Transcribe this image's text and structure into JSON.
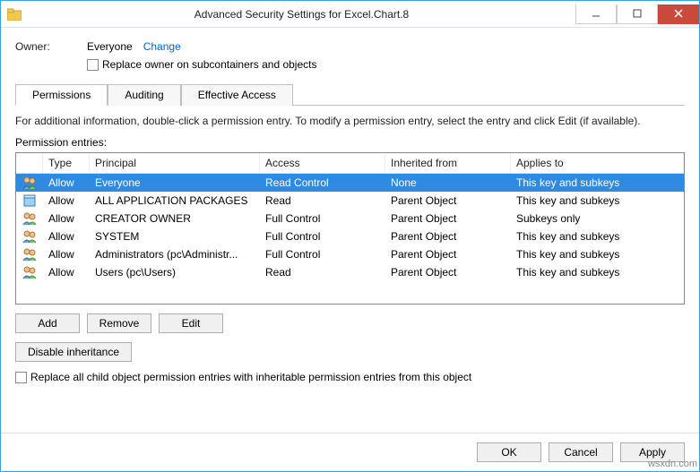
{
  "window": {
    "title": "Advanced Security Settings for Excel.Chart.8"
  },
  "owner": {
    "label": "Owner:",
    "value": "Everyone",
    "change_link": "Change",
    "replace_checkbox": "Replace owner on subcontainers and objects"
  },
  "tabs": {
    "permissions": "Permissions",
    "auditing": "Auditing",
    "effective_access": "Effective Access"
  },
  "info_text": "For additional information, double-click a permission entry. To modify a permission entry, select the entry and click Edit (if available).",
  "entries_label": "Permission entries:",
  "columns": {
    "type": "Type",
    "principal": "Principal",
    "access": "Access",
    "inherited": "Inherited from",
    "applies": "Applies to"
  },
  "rows": [
    {
      "type": "Allow",
      "principal": "Everyone",
      "access": "Read Control",
      "inherited": "None",
      "applies": "This key and subkeys",
      "icon": "users",
      "selected": true
    },
    {
      "type": "Allow",
      "principal": "ALL APPLICATION PACKAGES",
      "access": "Read",
      "inherited": "Parent Object",
      "applies": "This key and subkeys",
      "icon": "package",
      "selected": false
    },
    {
      "type": "Allow",
      "principal": "CREATOR OWNER",
      "access": "Full Control",
      "inherited": "Parent Object",
      "applies": "Subkeys only",
      "icon": "users",
      "selected": false
    },
    {
      "type": "Allow",
      "principal": "SYSTEM",
      "access": "Full Control",
      "inherited": "Parent Object",
      "applies": "This key and subkeys",
      "icon": "users",
      "selected": false
    },
    {
      "type": "Allow",
      "principal": "Administrators (pc\\Administr...",
      "access": "Full Control",
      "inherited": "Parent Object",
      "applies": "This key and subkeys",
      "icon": "users",
      "selected": false
    },
    {
      "type": "Allow",
      "principal": "Users (pc\\Users)",
      "access": "Read",
      "inherited": "Parent Object",
      "applies": "This key and subkeys",
      "icon": "users",
      "selected": false
    }
  ],
  "buttons": {
    "add": "Add",
    "remove": "Remove",
    "edit": "Edit",
    "disable": "Disable inheritance",
    "ok": "OK",
    "cancel": "Cancel",
    "apply": "Apply"
  },
  "replace_children_checkbox": "Replace all child object permission entries with inheritable permission entries from this object",
  "watermark": "wsxdn.com"
}
